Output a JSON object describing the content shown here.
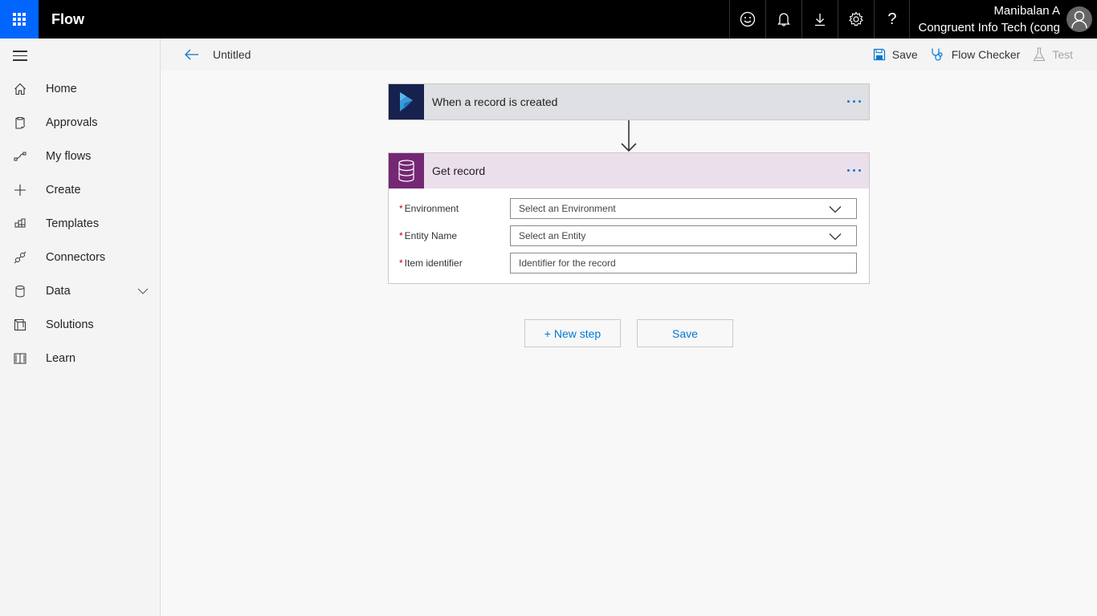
{
  "app": {
    "title": "Flow",
    "waffle_icon": "app-launcher-icon"
  },
  "topbar": {
    "icons": [
      {
        "name": "feedback-smiley-icon",
        "glyph": "☺"
      },
      {
        "name": "notifications-bell-icon",
        "glyph": "bell"
      },
      {
        "name": "download-icon",
        "glyph": "↓"
      },
      {
        "name": "settings-gear-icon",
        "glyph": "⚙"
      },
      {
        "name": "help-icon",
        "glyph": "?"
      }
    ],
    "user_name": "Manibalan A",
    "tenant": "Congruent Info Tech (cong"
  },
  "sidebar": {
    "items": [
      {
        "label": "Home",
        "icon": "home-icon"
      },
      {
        "label": "Approvals",
        "icon": "clipboard-check-icon"
      },
      {
        "label": "My flows",
        "icon": "flow-icon"
      },
      {
        "label": "Create",
        "icon": "plus-icon"
      },
      {
        "label": "Templates",
        "icon": "templates-icon"
      },
      {
        "label": "Connectors",
        "icon": "plug-icon"
      },
      {
        "label": "Data",
        "icon": "database-icon",
        "expandable": true
      },
      {
        "label": "Solutions",
        "icon": "solutions-icon"
      },
      {
        "label": "Learn",
        "icon": "book-icon"
      }
    ]
  },
  "commandbar": {
    "flow_name": "Untitled",
    "save_label": "Save",
    "checker_label": "Flow Checker",
    "test_label": "Test"
  },
  "canvas": {
    "trigger": {
      "title": "When a record is created",
      "color": "#16214d",
      "header_bg": "#dfe0e4"
    },
    "action": {
      "title": "Get record",
      "color": "#742774",
      "header_bg": "#ebdfeb",
      "fields": [
        {
          "label": "Environment",
          "required": true,
          "type": "dropdown",
          "placeholder": "Select an Environment"
        },
        {
          "label": "Entity Name",
          "required": true,
          "type": "dropdown",
          "placeholder": "Select an Entity"
        },
        {
          "label": "Item identifier",
          "required": true,
          "type": "text",
          "placeholder": "Identifier for the record"
        }
      ]
    },
    "new_step_label": "+ New step",
    "save_label": "Save"
  },
  "colors": {
    "accent": "#0078d4",
    "waffle_bg": "#0066ff",
    "topbar_bg": "#000000",
    "required": "#cc0000"
  }
}
